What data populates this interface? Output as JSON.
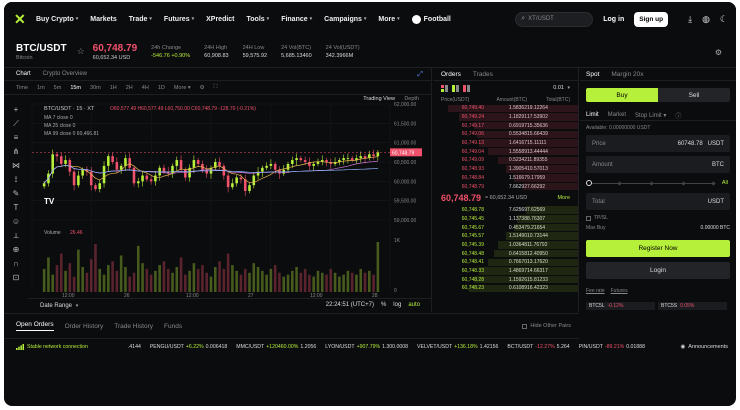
{
  "nav": {
    "items": [
      {
        "label": "Buy Crypto",
        "chev": true
      },
      {
        "label": "Markets",
        "chev": false
      },
      {
        "label": "Trade",
        "chev": true
      },
      {
        "label": "Futures",
        "chev": true
      },
      {
        "label": "XPredict",
        "chev": false
      },
      {
        "label": "Tools",
        "chev": true
      },
      {
        "label": "Finance",
        "chev": true
      },
      {
        "label": "Campaigns",
        "chev": true
      },
      {
        "label": "More",
        "chev": true
      }
    ],
    "football": "Football",
    "search_text": "XT/USDT",
    "login": "Log in",
    "signup": "Sign up"
  },
  "ticker": {
    "pair": "BTC/USDT",
    "pair_sub": "Bitcoin",
    "price": "60,748.79",
    "price_usd": "60,652.34 USD",
    "stats": [
      {
        "label": "24h Change",
        "value": "-546.76 +0.90%",
        "green": true
      },
      {
        "label": "24H High",
        "value": "60,908.83",
        "green": false
      },
      {
        "label": "24H Low",
        "value": "59,575.92",
        "green": false
      },
      {
        "label": "24 Vol(BTC)",
        "value": "5,685.13460",
        "green": false
      },
      {
        "label": "24 Vol(USDT)",
        "value": "342.3966M",
        "green": false
      }
    ]
  },
  "chart": {
    "tabs": [
      "Chart",
      "Crypto Overview"
    ],
    "timeframes": [
      "Time",
      "1m",
      "5m",
      "15m",
      "30m",
      "1H",
      "2H",
      "4H",
      "1D",
      "More"
    ],
    "active_tf": "15m",
    "tradingview": "Trading View",
    "depth": "Depth",
    "legend_pair": "BTC/USDT · 15 · XT",
    "legend_ohlc": "O60,577.49 H60,577.49 L60,750.00 C60,748.79 -128.70 (-0.21%)",
    "legend_lines": [
      "MA 7 close 0",
      "MA 25 close 0",
      "MA 99 close 0 60,466.81"
    ],
    "volume_label": "Volume",
    "volume_value": "26.46",
    "price_tag": "60,748.79",
    "yticks": [
      "62,000.00",
      "61,500.00",
      "61,000.00",
      "60,500.00",
      "60,000.00",
      "59,500.00",
      "59,000.00",
      "1K",
      "0"
    ],
    "xticks": [
      "12:00",
      "26",
      "12:00",
      "27",
      "12:00",
      "28"
    ],
    "date_range": "Date Range",
    "clock": "22:24:51 (UTC+7)",
    "pct": "%",
    "log": "log",
    "auto": "auto"
  },
  "chart_data": {
    "type": "candlestick",
    "title": "",
    "ylim": [
      59000,
      62000
    ],
    "ma_periods": [
      7,
      25,
      99
    ],
    "price_series": [
      59950,
      60200,
      60700,
      60650,
      60450,
      60550,
      60250,
      59900,
      60150,
      60300,
      60250,
      59900,
      59800,
      59950,
      60400,
      60650,
      60500,
      60300,
      60400,
      60600,
      60350,
      59950,
      60000,
      60150,
      60050,
      60000,
      60150,
      60350,
      60250,
      60200,
      60400,
      60550,
      60300,
      60100,
      60350,
      60550,
      60450,
      60300,
      60200,
      60350,
      60500,
      60400,
      60150,
      59850,
      59950,
      60100,
      60050,
      59750,
      59900,
      60150,
      60250,
      60350,
      60400,
      60450,
      60300,
      60200,
      60300,
      60450,
      60550,
      60600,
      60550,
      60500,
      60400,
      60450,
      60500,
      60550,
      60500,
      60450,
      60500,
      60550,
      60600,
      60600,
      60550,
      60600,
      60650,
      60600,
      60700,
      60650,
      60750
    ],
    "volume_series": [
      12,
      18,
      9,
      14,
      20,
      11,
      15,
      8,
      22,
      13,
      10,
      17,
      25,
      12,
      9,
      14,
      16,
      11,
      19,
      13,
      8,
      10,
      24,
      15,
      12,
      9,
      11,
      14,
      16,
      12,
      10,
      13,
      18,
      9,
      11,
      15,
      12,
      14,
      10,
      8,
      13,
      16,
      12,
      20,
      14,
      11,
      9,
      12,
      10,
      15,
      13,
      11,
      9,
      12,
      14,
      10,
      8,
      9,
      11,
      13,
      10,
      12,
      9,
      8,
      11,
      10,
      9,
      12,
      10,
      8,
      9,
      11,
      10,
      9,
      12,
      10,
      11,
      9,
      26
    ]
  },
  "orderbook": {
    "tabs": [
      "Orders",
      "Trades"
    ],
    "step": "0.01",
    "headers": [
      "Price(USDT)",
      "Amount(BTC)",
      "Total(BTC)"
    ],
    "asks": [
      [
        "60,749.40",
        "1.58362",
        "19.12264",
        0.9
      ],
      [
        "60,749.24",
        "1.18291",
        "17.53902",
        0.82
      ],
      [
        "60,749.17",
        "0.69197",
        "15.35636",
        0.72
      ],
      [
        "60,749.06",
        "0.55348",
        "15.66439",
        0.7
      ],
      [
        "60,749.13",
        "1.64167",
        "15.11111",
        0.68
      ],
      [
        "60,749.04",
        "1.55589",
        "13.44444",
        0.62
      ],
      [
        "60,749.09",
        "0.52342",
        "11.89355",
        0.55
      ],
      [
        "60,748.93",
        "1.39054",
        "10.57013",
        0.5
      ],
      [
        "60,748.84",
        "1.51667",
        "9.17959",
        0.44
      ],
      [
        "60,748.79",
        "7.66292",
        "7.66292",
        0.38
      ]
    ],
    "mid_price": "60,748.79",
    "mid_sub": "≈ 60,652.34 USD",
    "mid_more": "More",
    "bids": [
      [
        "60,748.78",
        "7.62569",
        "7.62569",
        0.36
      ],
      [
        "60,745.45",
        "1.13738",
        "8.76307",
        0.42
      ],
      [
        "60,745.67",
        "0.45347",
        "9.21654",
        0.44
      ],
      [
        "60,745.57",
        "1.51490",
        "10.73144",
        0.5
      ],
      [
        "60,745.39",
        "1.03648",
        "11.76792",
        0.55
      ],
      [
        "60,748.48",
        "0.64158",
        "12.40950",
        0.58
      ],
      [
        "60,748.41",
        "0.76670",
        "13.17620",
        0.62
      ],
      [
        "60,748.33",
        "1.48697",
        "14.66317",
        0.68
      ],
      [
        "60,748.28",
        "1.15926",
        "15.81233",
        0.72
      ],
      [
        "60,748.23",
        "0.61089",
        "16.42323",
        0.75
      ]
    ]
  },
  "trade": {
    "tabs": [
      "Spot",
      "Margin 20x"
    ],
    "buy": "Buy",
    "sell": "Sell",
    "order_tabs": [
      "Limit",
      "Market",
      "Stop Limit"
    ],
    "available": "Available: 0.00000000 USDT",
    "price_label": "Price",
    "price_value": "60748.78",
    "price_unit": "USDT",
    "amount_label": "Amount",
    "amount_unit": "BTC",
    "slider_all": "All",
    "total_label": "Total",
    "total_unit": "USDT",
    "tpsl": "TP/SL",
    "maxbuy_label": "Max Buy",
    "maxbuy_value": "0.00000 BTC",
    "register": "Register Now",
    "login": "Login",
    "fee": [
      "Fee rate",
      "Futures"
    ],
    "mini": [
      {
        "name": "BTC5L",
        "chg": "-0.12%"
      },
      {
        "name": "BTC5S",
        "chg": "0.05%"
      }
    ]
  },
  "orders": {
    "tabs": [
      "Open Orders",
      "Order History",
      "Trade History",
      "Funds"
    ],
    "hide_pairs": "Hide Other Pairs"
  },
  "status": {
    "connection": "Stable network connection",
    "markets": [
      {
        "n": "",
        "c": "",
        "v": ".4144",
        "cls": "v"
      },
      {
        "n": "PENGU/USDT",
        "c": "+6.22%",
        "v": "0.006418",
        "cls": "g"
      },
      {
        "n": "MMC/USDT",
        "c": "+120460.00%",
        "v": "1.2056",
        "cls": "g"
      },
      {
        "n": "LYON/USDT",
        "c": "+907.79%",
        "v": "1.300.0008",
        "cls": "g"
      },
      {
        "n": "VELVET/USDT",
        "c": "+136.18%",
        "v": "1.42156",
        "cls": "g"
      },
      {
        "n": "BCT/USDT",
        "c": "-12.27%",
        "v": "5.264",
        "cls": "r"
      },
      {
        "n": "PIN/USDT",
        "c": "-89.21%",
        "v": "0.01888",
        "cls": "r"
      }
    ],
    "announcements": "Announcements"
  }
}
